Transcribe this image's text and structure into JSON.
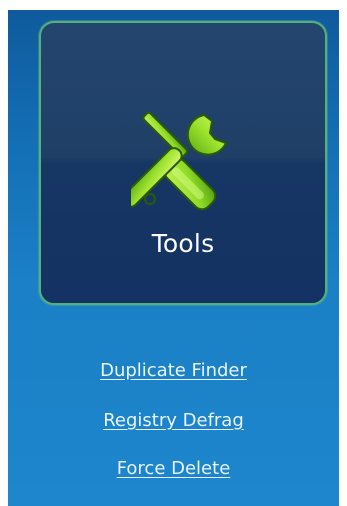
{
  "tools_card": {
    "label": "Tools",
    "icon": "tools-icon"
  },
  "links": [
    {
      "label": "Duplicate Finder"
    },
    {
      "label": "Registry Defrag"
    },
    {
      "label": "Force Delete"
    }
  ],
  "colors": {
    "panel_top": "#0f5a9d",
    "panel_bottom": "#1d86cc",
    "card_bg": "#163664",
    "card_border": "#55b07a",
    "icon_green": "#9be22d",
    "text": "#ffffff"
  }
}
